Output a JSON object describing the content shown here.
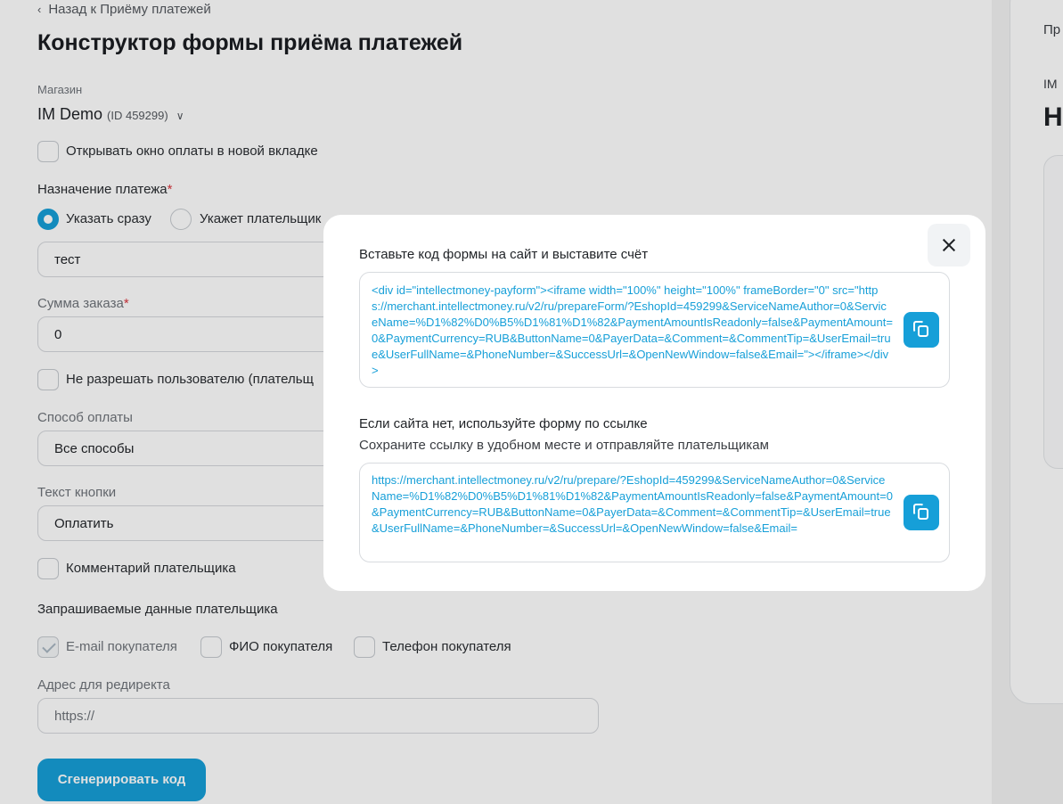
{
  "nav": {
    "back_label": "Назад к Приёму платежей"
  },
  "page": {
    "title": "Конструктор формы приёма платежей"
  },
  "store": {
    "label": "Магазин",
    "name": "IM Demo",
    "id": "(ID 459299)"
  },
  "form": {
    "new_tab_label": "Открывать окно оплаты в новой вкладке",
    "purpose": {
      "label": "Назначение платежа",
      "required_mark": "*",
      "option_now": "Указать сразу",
      "option_payer": "Укажет плательщик",
      "value": "тест"
    },
    "amount": {
      "label": "Сумма заказа",
      "required_mark": "*",
      "value": "0"
    },
    "no_change_label": "Не разрешать пользователю (плательщ",
    "payment_method": {
      "label": "Способ оплаты",
      "value": "Все способы"
    },
    "button_text": {
      "label": "Текст кнопки",
      "value": "Оплатить"
    },
    "comment_label": "Комментарий плательщика",
    "payer_data": {
      "heading": "Запрашиваемые данные плательщика",
      "email_label": "E-mail покупателя",
      "fio_label": "ФИО покупателя",
      "phone_label": "Телефон покупателя"
    },
    "redirect": {
      "label": "Адрес для редиректа",
      "placeholder": "https://"
    },
    "generate_label": "Сгенерировать код"
  },
  "right_panel": {
    "top_text": "Пр",
    "im_text": "IM",
    "big_text": "Н"
  },
  "modal": {
    "heading_code": "Вставьте код формы на сайт и выставите счёт",
    "code": "<div id=\"intellectmoney-payform\"><iframe width=\"100%\" height=\"100%\" frameBorder=\"0\" src=\"https://merchant.intellectmoney.ru/v2/ru/prepareForm/?EshopId=459299&ServiceNameAuthor=0&ServiceName=%D1%82%D0%B5%D1%81%D1%82&PaymentAmountIsReadonly=false&PaymentAmount=0&PaymentCurrency=RUB&ButtonName=0&PayerData=&Comment=&CommentTip=&UserEmail=true&UserFullName=&PhoneNumber=&SuccessUrl=&OpenNewWindow=false&Email=\"></iframe></div>",
    "heading_link": "Если сайта нет, используйте форму по ссылке",
    "sub_link": "Сохраните ссылку в удобном месте и отправляйте плательщикам",
    "link": "https://merchant.intellectmoney.ru/v2/ru/prepare/?EshopId=459299&ServiceNameAuthor=0&ServiceName=%D1%82%D0%B5%D1%81%D1%82&PaymentAmountIsReadonly=false&PaymentAmount=0&PaymentCurrency=RUB&ButtonName=0&PayerData=&Comment=&CommentTip=&UserEmail=true&UserFullName=&PhoneNumber=&SuccessUrl=&OpenNewWindow=false&Email="
  },
  "colors": {
    "accent": "#169fd8",
    "required": "#d9363e"
  }
}
